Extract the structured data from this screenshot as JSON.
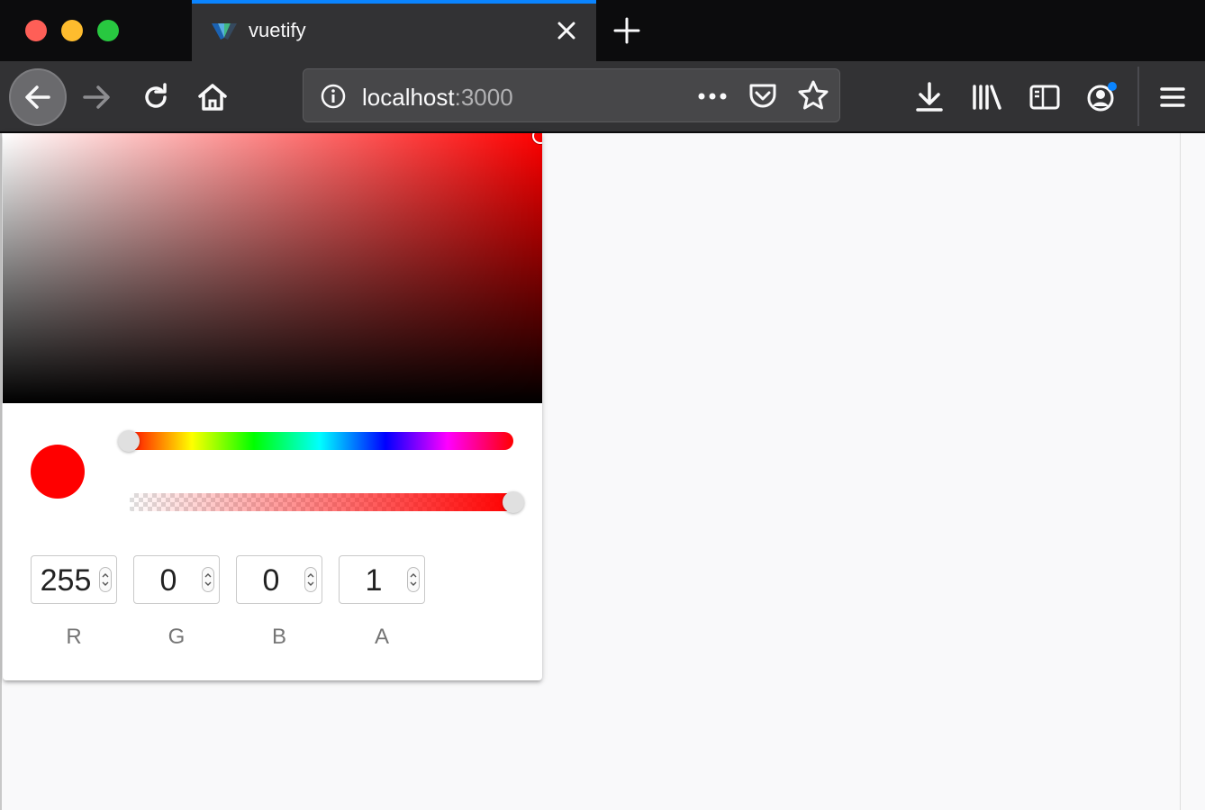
{
  "window": {
    "controls": [
      "close",
      "minimize",
      "maximize"
    ]
  },
  "tab": {
    "title": "vuetify",
    "icon": "vuetify-logo-icon"
  },
  "toolbar": {
    "url_host": "localhost",
    "url_port": ":3000",
    "icons": [
      "back-arrow-icon",
      "forward-arrow-icon",
      "reload-icon",
      "home-icon",
      "info-icon",
      "more-icon",
      "pocket-icon",
      "bookmark-star-icon",
      "download-icon",
      "library-icon",
      "sidebar-icon",
      "account-icon",
      "menu-icon"
    ]
  },
  "color_picker": {
    "selected_color": "#ff0000",
    "hue_value": 0,
    "alpha_value": 1,
    "fields": [
      {
        "label": "R",
        "value": "255"
      },
      {
        "label": "G",
        "value": "0"
      },
      {
        "label": "B",
        "value": "0"
      },
      {
        "label": "A",
        "value": "1"
      }
    ]
  },
  "colors": {
    "accent": "#0a84ff",
    "toolbar": "#323234",
    "titlebar": "#0c0c0d"
  }
}
